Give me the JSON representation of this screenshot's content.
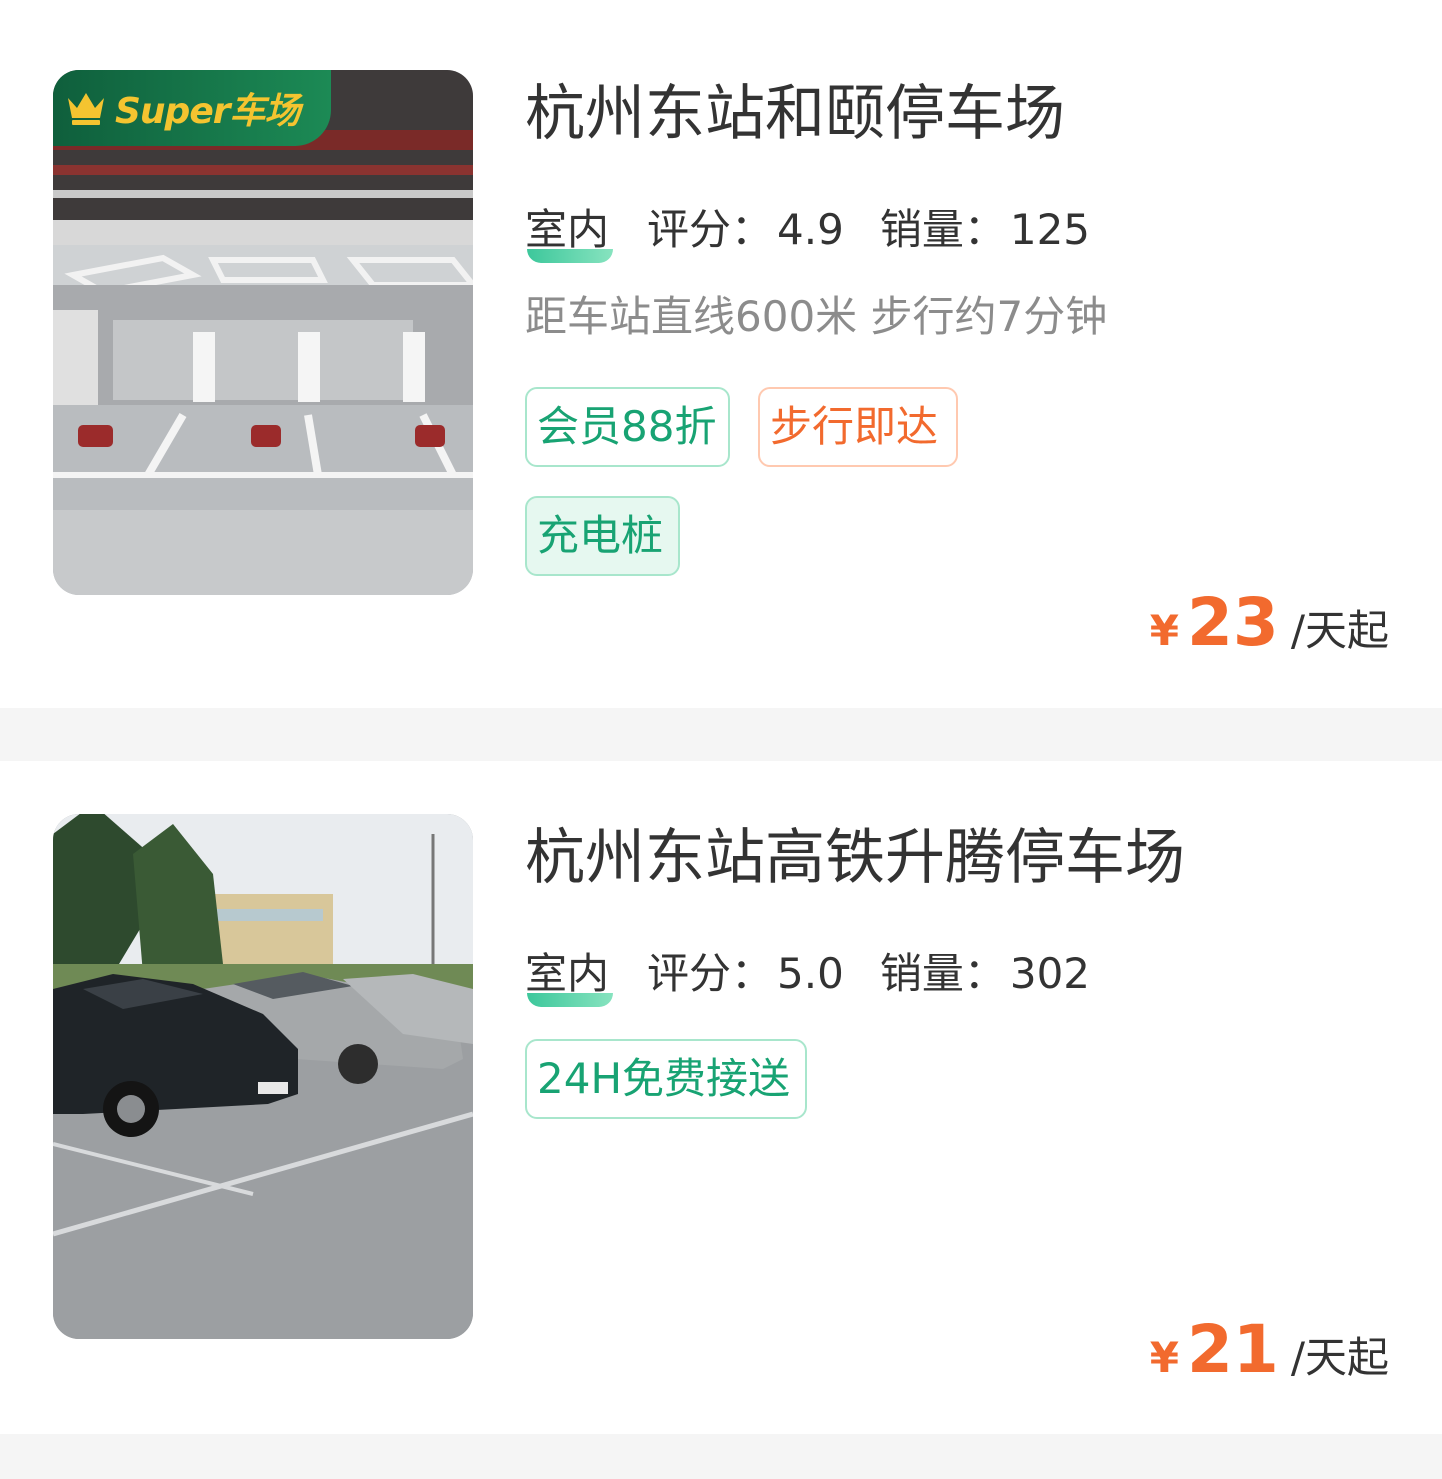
{
  "listings": [
    {
      "super_badge": "Super车场",
      "title": "杭州东站和颐停车场",
      "type": "室内",
      "rating_label": "评分：",
      "rating": "4.9",
      "sales_label": "销量：",
      "sales": "125",
      "distance": "距车站直线600米 步行约7分钟",
      "tags": [
        "会员88折",
        "步行即达",
        "充电桩"
      ],
      "price_symbol": "¥",
      "price": "23",
      "price_unit": "/天起"
    },
    {
      "title": "杭州东站高铁升腾停车场",
      "type": "室内",
      "rating_label": "评分：",
      "rating": "5.0",
      "sales_label": "销量：",
      "sales": "302",
      "tags": [
        "24H免费接送"
      ],
      "price_symbol": "¥",
      "price": "21",
      "price_unit": "/天起"
    }
  ],
  "colors": {
    "accent_green": "#18a373",
    "accent_orange": "#f26a2e",
    "badge_gold": "#f4c430",
    "badge_green": "#1c8a55"
  },
  "icons": [
    "crown-icon"
  ]
}
